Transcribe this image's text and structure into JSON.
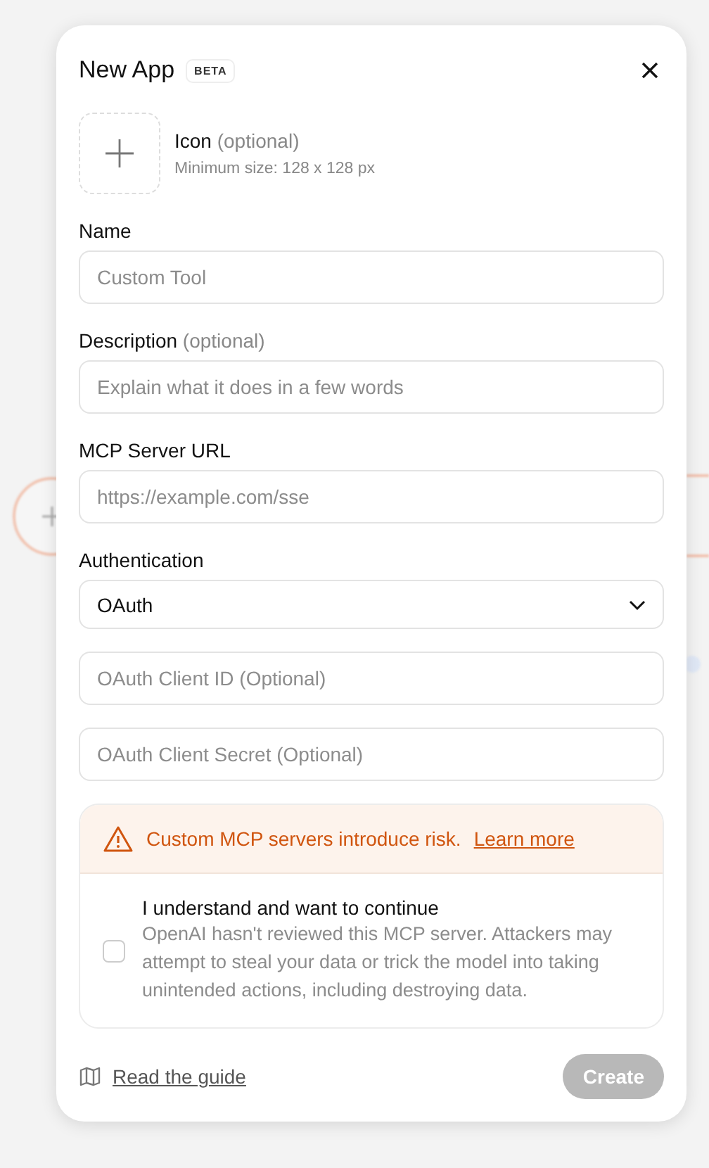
{
  "dialog": {
    "title": "New App",
    "badge": "BETA"
  },
  "icon_upload": {
    "label": "Icon",
    "optional": "(optional)",
    "hint": "Minimum size: 128 x 128 px"
  },
  "fields": [
    {
      "kind": "text",
      "label": "Name",
      "placeholder": "Custom Tool"
    },
    {
      "kind": "text",
      "label": "Description",
      "optional": "(optional)",
      "placeholder": "Explain what it does in a few words"
    },
    {
      "kind": "text",
      "label": "MCP Server URL",
      "placeholder": "https://example.com/sse"
    },
    {
      "kind": "select",
      "label": "Authentication",
      "value": "OAuth"
    },
    {
      "kind": "text",
      "placeholder": "OAuth Client ID (Optional)"
    },
    {
      "kind": "text",
      "placeholder": "OAuth Client Secret (Optional)"
    }
  ],
  "warning": {
    "message": "Custom MCP servers introduce risk.",
    "link": "Learn more"
  },
  "consent": {
    "title": "I understand and want to continue",
    "text": "OpenAI hasn't reviewed this MCP server. Attackers may attempt to steal your data or trick the model into taking unintended actions, including destroying data.",
    "checked": false
  },
  "footer": {
    "guide_link": "Read the guide",
    "create_button": {
      "label": "Create",
      "disabled": true
    }
  }
}
